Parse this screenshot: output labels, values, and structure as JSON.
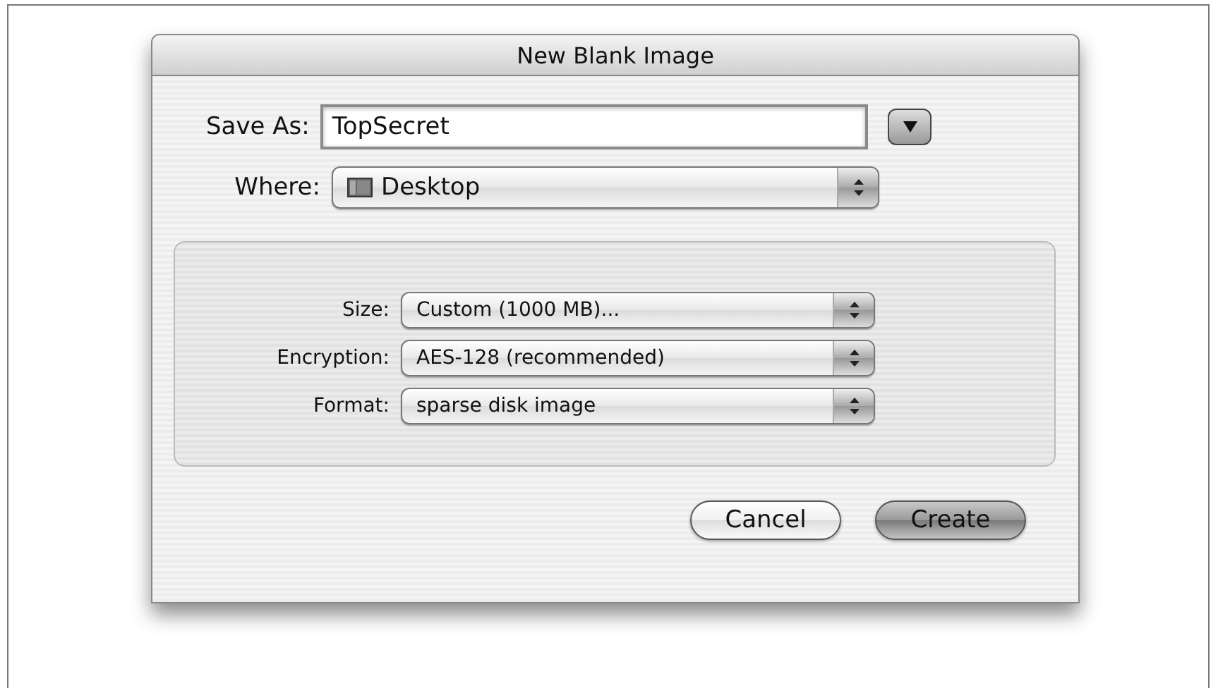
{
  "window": {
    "title": "New Blank Image"
  },
  "save_as": {
    "label": "Save As:",
    "value": "TopSecret",
    "expanded": false
  },
  "where": {
    "label": "Where:",
    "value": "Desktop"
  },
  "options": [
    {
      "label": "Size:",
      "value": "Custom (1000 MB)..."
    },
    {
      "label": "Encryption:",
      "value": "AES-128 (recommended)"
    },
    {
      "label": "Format:",
      "value": "sparse disk image"
    }
  ],
  "buttons": [
    {
      "label": "Cancel",
      "default": false
    },
    {
      "label": "Create",
      "default": true
    }
  ]
}
